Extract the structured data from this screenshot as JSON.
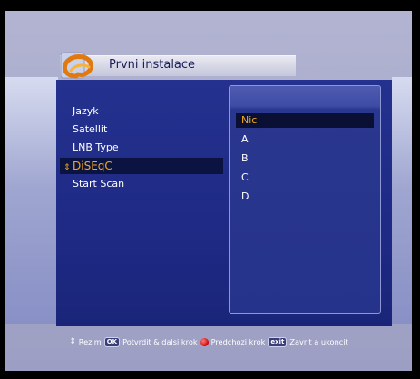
{
  "title": "Prvni instalace",
  "menu": {
    "items": [
      {
        "label": "Jazyk"
      },
      {
        "label": "Satellit"
      },
      {
        "label": "LNB Type"
      },
      {
        "label": "DiSEqC",
        "selected_marker": "⇕"
      },
      {
        "label": "Start Scan"
      }
    ],
    "selected_index": 3
  },
  "dropdown": {
    "options": [
      "Nic",
      "A",
      "B",
      "C",
      "D"
    ],
    "selected_index": 0
  },
  "footer": {
    "mode_icon": "⇕",
    "mode_label": "Rezim",
    "ok_key": "OK",
    "ok_label": "Potvrdit & dalsi krok",
    "prev_label": "Predchozi krok",
    "exit_key": "exit",
    "exit_label": "Zavrit a ukoncit"
  },
  "colors": {
    "panel": "#24318e",
    "highlight_text": "#f7a81d",
    "title_text": "#1a1f5a"
  },
  "icons": {
    "logo": "q-swirl-logo-icon",
    "prev_key": "red-button-icon"
  }
}
